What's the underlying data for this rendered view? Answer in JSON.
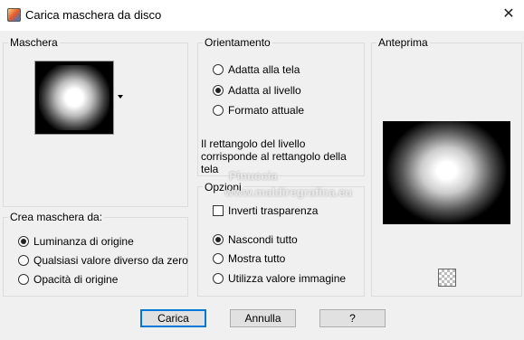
{
  "window": {
    "title": "Carica maschera da disco",
    "close_label": "✕"
  },
  "maschera": {
    "label": "Maschera"
  },
  "crea": {
    "label": "Crea maschera da:",
    "options": [
      {
        "label": "Luminanza di origine",
        "selected": true
      },
      {
        "label": "Qualsiasi valore diverso da zero",
        "selected": false
      },
      {
        "label": "Opacità di origine",
        "selected": false
      }
    ]
  },
  "orientamento": {
    "label": "Orientamento",
    "options": [
      {
        "label": "Adatta alla tela",
        "selected": false
      },
      {
        "label": "Adatta al livello",
        "selected": true
      },
      {
        "label": "Formato attuale",
        "selected": false
      }
    ],
    "info_line1": "Il rettangolo del livello",
    "info_line2": "corrisponde al rettangolo della",
    "info_line3": "tela"
  },
  "opzioni": {
    "label": "Opzioni",
    "invert_label": "Inverti trasparenza",
    "invert_checked": false,
    "options": [
      {
        "label": "Nascondi tutto",
        "selected": true
      },
      {
        "label": "Mostra tutto",
        "selected": false
      },
      {
        "label": "Utilizza valore immagine",
        "selected": false
      }
    ]
  },
  "anteprima": {
    "label": "Anteprima"
  },
  "watermark": {
    "line1": "Pinuccia",
    "line2": "www.maldiregrafica.eu"
  },
  "buttons": {
    "ok": "Carica",
    "cancel": "Annulla",
    "help": "?"
  }
}
